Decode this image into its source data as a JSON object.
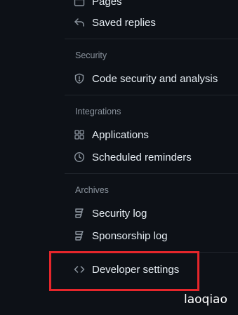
{
  "sidebar": {
    "top_items": [
      {
        "label": "Pages",
        "icon": "browser-icon"
      },
      {
        "label": "Saved replies",
        "icon": "reply-icon"
      }
    ],
    "security": {
      "title": "Security",
      "items": [
        {
          "label": "Code security and analysis",
          "icon": "shield-icon"
        }
      ]
    },
    "integrations": {
      "title": "Integrations",
      "items": [
        {
          "label": "Applications",
          "icon": "apps-grid-icon"
        },
        {
          "label": "Scheduled reminders",
          "icon": "clock-icon"
        }
      ]
    },
    "archives": {
      "title": "Archives",
      "items": [
        {
          "label": "Security log",
          "icon": "log-icon"
        },
        {
          "label": "Sponsorship log",
          "icon": "log-icon"
        }
      ]
    },
    "developer": {
      "label": "Developer settings",
      "icon": "code-icon"
    }
  },
  "annotation": {
    "highlight_color": "#e5262b"
  },
  "watermark": {
    "text": "laoqiao"
  },
  "colors": {
    "background": "#0d1117",
    "text": "#e6edf3",
    "muted": "#8b949e",
    "divider": "#21262d"
  }
}
